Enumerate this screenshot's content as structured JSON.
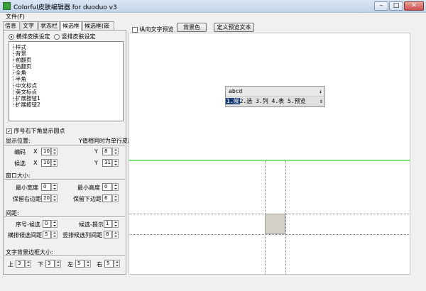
{
  "window": {
    "title": "Colorful皮肤编辑器 for duoduo v3",
    "min": "–",
    "max": "□",
    "close": "✕"
  },
  "menu": {
    "file": "文件(F)"
  },
  "tabs": [
    "信息",
    "文字",
    "状态栏",
    "候选框",
    "候选框(嵌入)"
  ],
  "active_tab": 3,
  "skin_mode": {
    "horizontal": "横排皮肤设定",
    "vertical": "竖排皮肤设定",
    "selected": "horizontal"
  },
  "tree": {
    "items": [
      "样式",
      "背景",
      "前翻页",
      "后翻页",
      "全角",
      "半角",
      "中文标点",
      "英文标点",
      "扩展按钮1",
      "扩展按钮2"
    ]
  },
  "show_dot": {
    "label": "序号右下角显示圆点",
    "checked": true
  },
  "display_pos": {
    "title": "显示位置:",
    "note": "Y值相同时为单行皮肤",
    "code_label": "编码",
    "cand_label": "候选",
    "x_label": "X",
    "y_label": "Y",
    "code_x": "10",
    "code_y": "8",
    "cand_x": "10",
    "cand_y": "31"
  },
  "window_size": {
    "title": "窗口大小:",
    "min_width_label": "最小宽度",
    "min_height_label": "最小高度",
    "keep_right_label": "保留右边距",
    "keep_bottom_label": "保留下边距",
    "min_width": "0",
    "min_height": "0",
    "keep_right": "20",
    "keep_bottom": "6"
  },
  "spacing": {
    "title": "间距:",
    "seq_cand_label": "序号-候选",
    "cand_hint_label": "候选-提示",
    "h_spacing_label": "横排候选间距",
    "v_spacing_label": "竖排候选列间距",
    "seq_cand": "0",
    "cand_hint": "1",
    "h_spacing": "5",
    "v_spacing": "8"
  },
  "text_bg": {
    "title": "文字背景边框大小:",
    "top_label": "上",
    "bottom_label": "下",
    "left_label": "左",
    "right_label": "右",
    "top": "3",
    "bottom": "3",
    "left": "5",
    "right": "5"
  },
  "toolbar": {
    "vertical_preview": "纵向文字预览",
    "bg_color": "背景色",
    "custom_preview": "定义预览文本"
  },
  "preview": {
    "input_text": "abcd",
    "highlight_candidate": "1.候",
    "rest_candidates": "2.选 3.列 4.表 5.预览",
    "marker": "⇣",
    "scroll": "⇕"
  },
  "colors": {
    "guide_line": "#7fe07f",
    "highlight": "#1f3e78",
    "canvas": "#ffffff"
  }
}
